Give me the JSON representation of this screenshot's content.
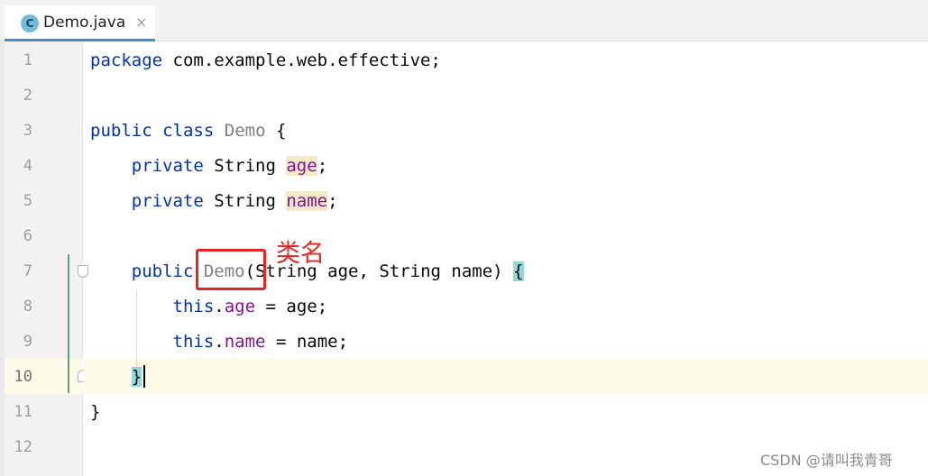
{
  "tab": {
    "icon_letter": "C",
    "filename": "Demo.java",
    "close_glyph": "×"
  },
  "gutter": {
    "line_numbers": [
      "1",
      "2",
      "3",
      "4",
      "5",
      "6",
      "7",
      "8",
      "9",
      "10",
      "11",
      "12"
    ],
    "current_line": "10"
  },
  "code": {
    "line1": {
      "kw": "package",
      "rest": " com.example.web.effective;"
    },
    "line3": {
      "kw1": "public",
      "kw2": "class",
      "cls": "Demo",
      "rest": " {"
    },
    "line4": {
      "kw": "private",
      "type": " String ",
      "field": "age",
      "end": ";"
    },
    "line5": {
      "kw": "private",
      "type": " String ",
      "field": "name",
      "end": ";"
    },
    "line7": {
      "kw": "public",
      "cls": "Demo",
      "params": "(String age, String name) ",
      "brace": "{"
    },
    "line8": {
      "kw": "this",
      "dot": ".",
      "field": "age",
      "rest": " = age;"
    },
    "line9": {
      "kw": "this",
      "dot": ".",
      "field": "name",
      "rest": " = name;"
    },
    "line10": {
      "brace": "}"
    },
    "line11": {
      "brace": "}"
    }
  },
  "annotation": {
    "label": "类名",
    "color": "#e8251f"
  },
  "watermark": "CSDN @请叫我青哥",
  "colors": {
    "keyword": "#0033b3",
    "field": "#871094",
    "unused_class": "#808080",
    "field_highlight": "#f5eac8",
    "brace_match": "#93d9d9",
    "current_line": "#fdfbe8",
    "tab_underline": "#4a88c7"
  }
}
